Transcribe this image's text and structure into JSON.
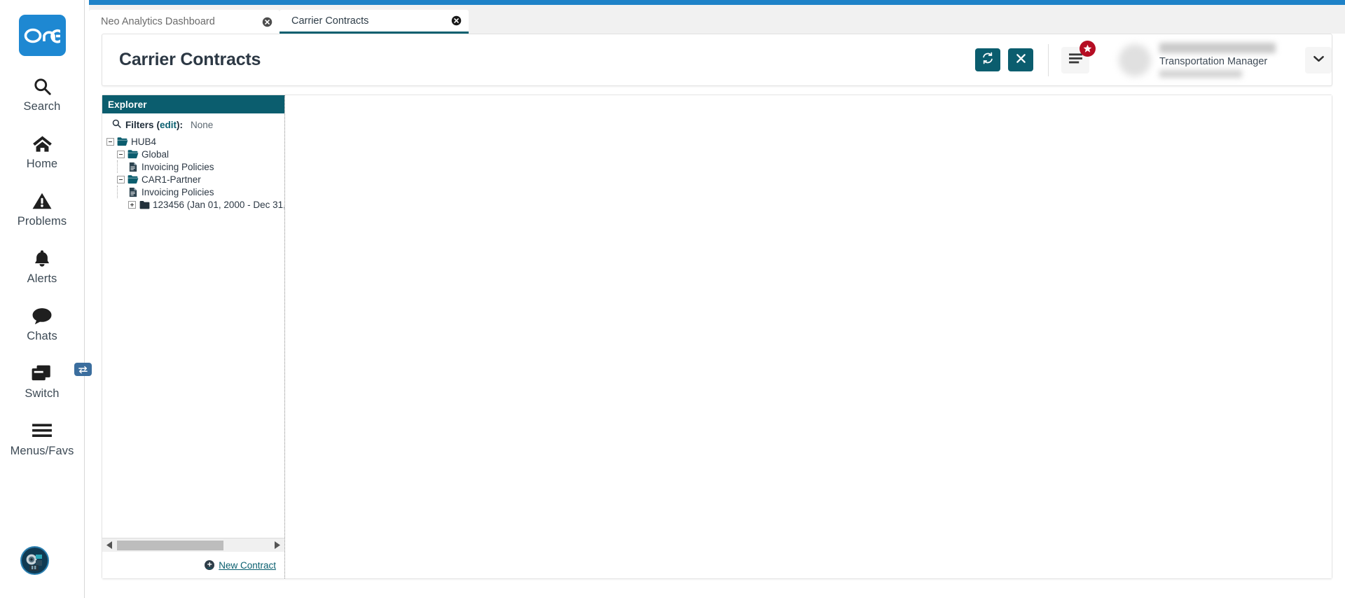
{
  "app": {
    "logo_text": "one",
    "accent_teal": "#0b5d6e",
    "accent_blue": "#1e82c8",
    "badge_red": "#b50d23"
  },
  "sidebar": {
    "items": [
      {
        "label": "Search",
        "icon": "search-icon"
      },
      {
        "label": "Home",
        "icon": "home-icon"
      },
      {
        "label": "Problems",
        "icon": "warning-triangle-icon"
      },
      {
        "label": "Alerts",
        "icon": "bell-icon"
      },
      {
        "label": "Chats",
        "icon": "chat-bubble-icon"
      },
      {
        "label": "Switch",
        "icon": "windows-stack-icon",
        "badge_icon": "swap-arrows-icon"
      },
      {
        "label": "Menus/Favs",
        "icon": "hamburger-icon"
      }
    ],
    "avatar_icon": "robot-avatar-icon"
  },
  "tabs": [
    {
      "label": "Neo Analytics Dashboard",
      "active": false,
      "close_icon": "close-circle-icon"
    },
    {
      "label": "Carrier Contracts",
      "active": true,
      "close_icon": "close-circle-icon"
    }
  ],
  "header": {
    "title": "Carrier Contracts",
    "refresh_icon": "refresh-icon",
    "close_icon": "x-icon",
    "menu_icon": "hamburger-menu-icon",
    "star_badge_icon": "star-icon",
    "user_role": "Transportation Manager",
    "caret_icon": "chevron-down-icon"
  },
  "explorer": {
    "title": "Explorer",
    "filters": {
      "search_icon": "magnifier-icon",
      "label": "Filters",
      "edit_label": "edit",
      "open_paren": "(",
      "close_paren": "):",
      "value": "None"
    },
    "tree": [
      {
        "label": "HUB4",
        "depth": 0,
        "toggle": "minus",
        "icon": "folder-open-icon"
      },
      {
        "label": "Global",
        "depth": 1,
        "toggle": "minus",
        "icon": "folder-open-icon"
      },
      {
        "label": "Invoicing Policies",
        "depth": 2,
        "toggle": "none",
        "icon": "document-icon"
      },
      {
        "label": "CAR1-Partner",
        "depth": 1,
        "toggle": "minus",
        "icon": "folder-open-icon"
      },
      {
        "label": "Invoicing Policies",
        "depth": 2,
        "toggle": "none",
        "icon": "document-icon"
      },
      {
        "label": "123456 (Jan 01, 2000 - Dec 31,",
        "depth": 2,
        "toggle": "plus",
        "icon": "folder-closed-icon"
      }
    ],
    "scrollbar": {
      "left_arrow_icon": "triangle-left-icon",
      "right_arrow_icon": "triangle-right-icon"
    },
    "footer": {
      "new_contract_label": "New Contract",
      "add_icon": "plus-circle-icon"
    }
  }
}
